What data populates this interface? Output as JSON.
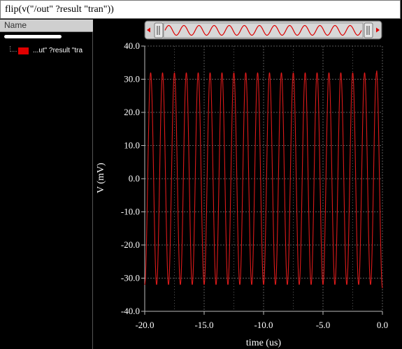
{
  "window": {
    "expression": "flip(v(\"/out\" ?result \"tran\"))"
  },
  "sidebar": {
    "column_header": "Name",
    "trace_label": "...ut\" ?result \"tra",
    "trace_color": "#e00000"
  },
  "colors": {
    "background": "#000000",
    "trace": "#dd1a1a",
    "grid": "#5a5a5a",
    "text": "#ffffff"
  },
  "icons": {
    "scroll_left": "triangle-left-icon",
    "scroll_right": "triangle-right-icon"
  },
  "chart_data": {
    "type": "line",
    "title": "",
    "xlabel": "time (us)",
    "ylabel": "V (mV)",
    "xlim": [
      -20.0,
      0.0
    ],
    "ylim": [
      -40.0,
      40.0
    ],
    "x_ticks": [
      "-20.0",
      "-15.0",
      "-10.0",
      "-5.0",
      "0.0"
    ],
    "y_ticks": [
      "40.0",
      "30.0",
      "20.0",
      "10.0",
      "0.0",
      "-10.0",
      "-20.0",
      "-30.0",
      "-40.0"
    ],
    "grid": true,
    "series": [
      {
        "color": "#dd1a1a",
        "waveform": "sine",
        "amplitude_mV": 32.0,
        "cycles_shown": 20,
        "x_range": [
          -20.0,
          0.0
        ],
        "end_value_mV": 33.0
      }
    ]
  }
}
